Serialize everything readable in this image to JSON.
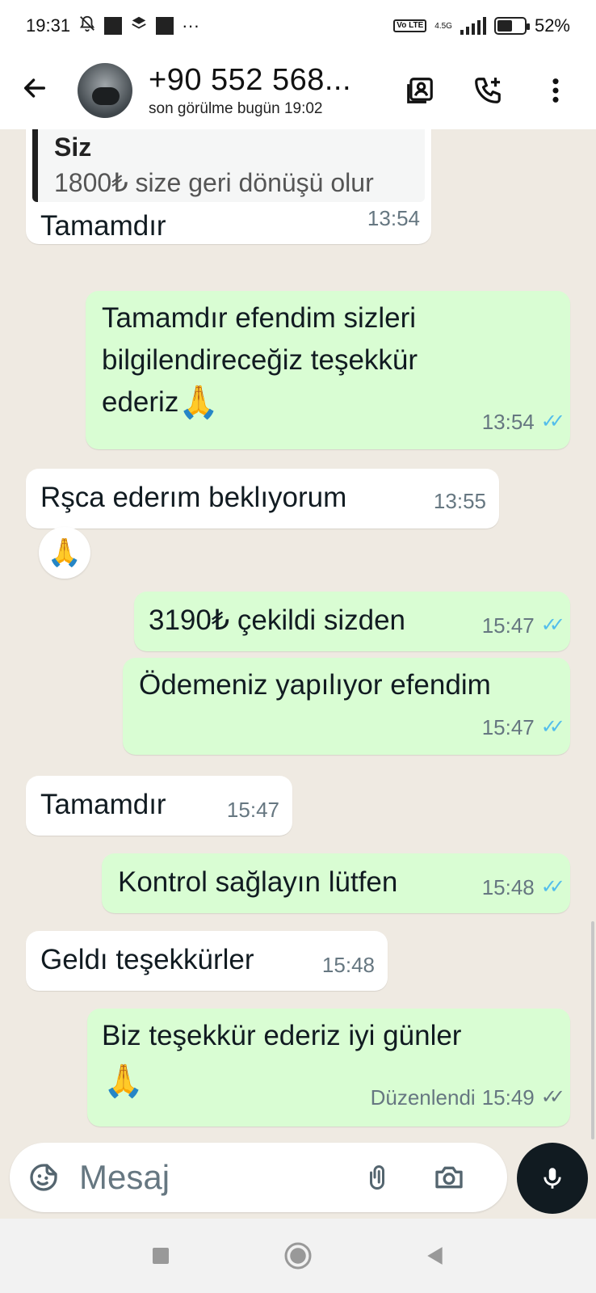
{
  "status_bar": {
    "time": "19:31",
    "dots": "···",
    "volte": "Vo LTE",
    "network": "4.5G",
    "battery": "52%"
  },
  "header": {
    "title": "+90 552 568...",
    "subtitle": "son görülme bugün 19:02",
    "icons": [
      "back-arrow-icon",
      "contact-card-icon",
      "add-call-icon",
      "more-vertical-icon"
    ]
  },
  "messages": [
    {
      "direction": "in",
      "quote_name": "Siz",
      "quote_text": "1800₺ size geri dönüşü olur",
      "text": "Tamamdır",
      "time": "13:54"
    },
    {
      "direction": "out",
      "lines": [
        "Tamamdır efendim sizleri",
        "bilgilendireceğiz teşekkür",
        "ederiz"
      ],
      "emoji": "🙏",
      "time": "13:54",
      "status": "read"
    },
    {
      "direction": "in",
      "text": "Rşca ederım beklıyorum",
      "time": "13:55",
      "reaction": "🙏"
    },
    {
      "direction": "out",
      "text": "3190₺ çekildi sizden",
      "time": "15:47",
      "status": "read"
    },
    {
      "direction": "out",
      "text": "Ödemeniz yapılıyor efendim",
      "time": "15:47",
      "status": "read"
    },
    {
      "direction": "in",
      "text": "Tamamdır",
      "time": "15:47"
    },
    {
      "direction": "out",
      "text": "Kontrol sağlayın lütfen",
      "time": "15:48",
      "status": "read"
    },
    {
      "direction": "in",
      "text": "Geldı teşekkürler",
      "time": "15:48"
    },
    {
      "direction": "out",
      "text": "Biz teşekkür ederiz iyi günler",
      "emoji": "🙏",
      "edited_label": "Düzenlendi",
      "time": "15:49",
      "status": "delivered"
    }
  ],
  "input": {
    "placeholder": "Mesaj"
  },
  "colors": {
    "incoming": "#ffffff",
    "outgoing": "#d9fdd3",
    "read_ticks": "#53bdeb",
    "background": "#efeae2"
  }
}
